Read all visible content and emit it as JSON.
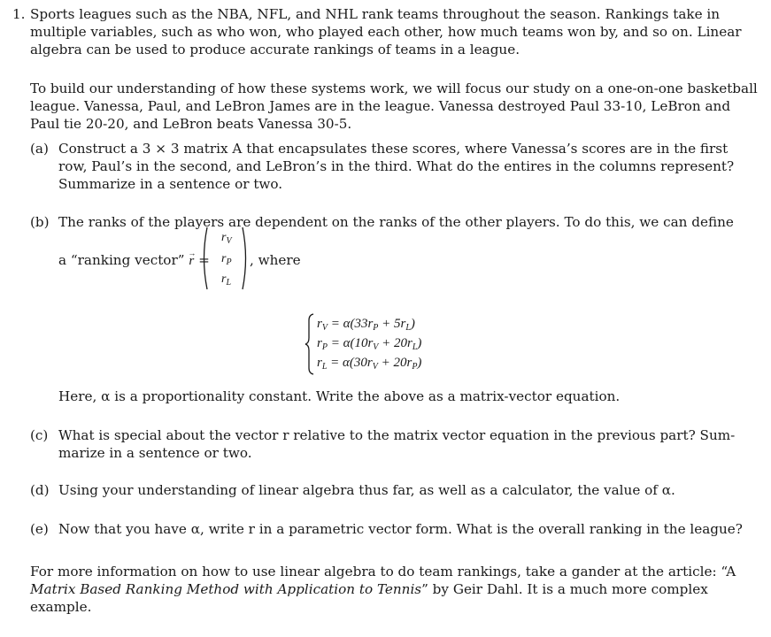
{
  "problem": {
    "number": "1.",
    "intro_lines": [
      "Sports leagues such as the NBA, NFL, and NHL rank teams throughout the season. Rankings take in",
      "multiple variables, such as who won, who played each other, how much teams won by, and so on. Linear",
      "algebra can be used to produce accurate rankings of teams in a league."
    ],
    "setup_lines": [
      "To build our understanding of how these systems work, we will focus our study on a one-on-one basketball",
      "league. Vanessa, Paul, and LeBron James are in the league. Vanessa destroyed Paul 33-10, LeBron and",
      "Paul tie 20-20, and LeBron beats Vanessa 30-5."
    ]
  },
  "parts": {
    "a": {
      "label": "(a)",
      "lines": [
        "Construct a 3 × 3 matrix A that encapsulates these scores, where Vanessa’s scores are in the first",
        "row, Paul’s in the second, and LeBron’s in the third. What do the entires in the columns represent?",
        "Summarize in a sentence or two."
      ]
    },
    "b": {
      "label": "(b)",
      "line1": "The ranks of the players are dependent on the ranks of the other players. To do this, we can define",
      "vector_prefix": "a “ranking vector”",
      "vector_symbol": "r",
      "equals": "=",
      "vector_entries": [
        {
          "base": "r",
          "sub": "V"
        },
        {
          "base": "r",
          "sub": "P"
        },
        {
          "base": "r",
          "sub": "L"
        }
      ],
      "vector_suffix": ", where",
      "equations": [
        {
          "lhs": "r",
          "lhs_sub": "V",
          "rhs": "= α(33r",
          "s1": "P",
          "mid": " + 5r",
          "s2": "L",
          "end": ")"
        },
        {
          "lhs": "r",
          "lhs_sub": "P",
          "rhs": "= α(10r",
          "s1": "V",
          "mid": " + 20r",
          "s2": "L",
          "end": ")"
        },
        {
          "lhs": "r",
          "lhs_sub": "L",
          "rhs": "= α(30r",
          "s1": "V",
          "mid": " + 20r",
          "s2": "P",
          "end": ")"
        }
      ],
      "closing": "Here, α is a proportionality constant. Write the above as a matrix-vector equation."
    },
    "c": {
      "label": "(c)",
      "lines": [
        "What is special about the vector r relative to the matrix vector equation in the previous part? Sum-",
        "marize in a sentence or two."
      ]
    },
    "d": {
      "label": "(d)",
      "line": "Using your understanding of linear algebra thus far, as well as a calculator, the value of α."
    },
    "e": {
      "label": "(e)",
      "line": "Now that you have α, write r in a parametric vector form. What is the overall ranking in the league?"
    }
  },
  "footer": {
    "line1_text": "For more information on how to use linear algebra to do team rankings, take a gander at the article: “A",
    "line2_italic": "Matrix Based Ranking Method with Application to Tennis",
    "line2_rest": "” by Geir Dahl.  It is a much more complex",
    "line3": "example."
  }
}
